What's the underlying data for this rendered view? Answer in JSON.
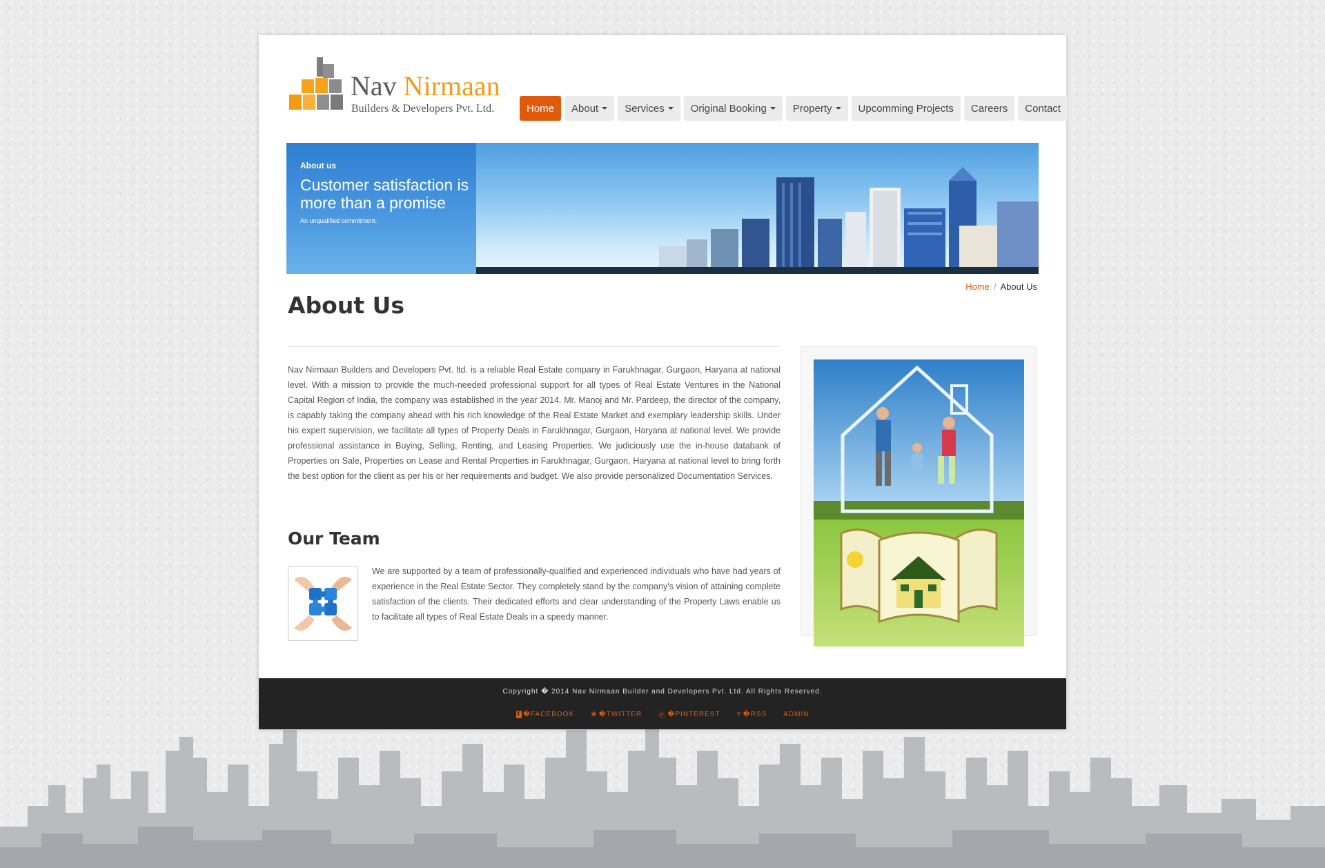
{
  "brand": {
    "name_first": "Nav",
    "name_second": "Nirmaan",
    "subtitle": "Builders & Developers Pvt. Ltd.",
    "accent_color": "#f39c12"
  },
  "nav": {
    "items": [
      {
        "label": "Home",
        "dropdown": false,
        "active": true
      },
      {
        "label": "About",
        "dropdown": true,
        "active": false
      },
      {
        "label": "Services",
        "dropdown": true,
        "active": false
      },
      {
        "label": "Original Booking",
        "dropdown": true,
        "active": false
      },
      {
        "label": "Property",
        "dropdown": true,
        "active": false
      },
      {
        "label": "Upcomming Projects",
        "dropdown": false,
        "active": false
      },
      {
        "label": "Careers",
        "dropdown": false,
        "active": false
      },
      {
        "label": "Contact",
        "dropdown": false,
        "active": false
      }
    ],
    "active_color": "#e05a0c"
  },
  "banner": {
    "eyebrow": "About us",
    "headline": "Customer satisfaction is more than a promise",
    "tagline": "An unqualified commitment."
  },
  "breadcrumb": {
    "home": "Home",
    "separator": "/",
    "current": "About Us"
  },
  "page": {
    "title": "About Us",
    "intro": "Nav Nirmaan Builders and Developers Pvt. ltd. is a reliable Real Estate company in Farukhnagar, Gurgaon, Haryana at national level. With a mission to provide the much-needed professional support for all types of Real Estate Ventures in the National Capital Region of India, the company was established in the year 2014. Mr. Manoj and Mr. Pardeep, the director of the company, is capably taking the company ahead with his rich knowledge of the Real Estate Market and exemplary leadership skills. Under his expert supervision, we facilitate all types of Property Deals in Farukhnagar, Gurgaon, Haryana at national level. We provide professional assistance in Buying, Selling, Renting, and Leasing Properties. We judiciously use the in-house databank of Properties on Sale, Properties on Lease and Rental Properties in Farukhnagar, Gurgaon, Haryana at national level to bring forth the best option for the client as per his or her requirements and budget. We also provide personalized Documentation Services.",
    "team_title": "Our Team",
    "team_text": "We are supported by a team of professionally-qualified and experienced individuals who have had years of experience in the Real Estate Sector. They completely stand by the company's vision of attaining complete satisfaction of the clients. Their dedicated efforts and clear understanding of the Property Laws enable us to facilitate all types of Real Estate Deals in a speedy manner."
  },
  "footer": {
    "copyright": "Copyright � 2014 Nav Nirmaan Builder and Developers Pvt. Ltd. All Rights Reserved.",
    "links": [
      {
        "icon": "facebook-icon",
        "glyph": "f",
        "label": "�FACEBOOK"
      },
      {
        "icon": "twitter-icon",
        "glyph": "❀",
        "label": "�TWITTER"
      },
      {
        "icon": "pinterest-icon",
        "glyph": "Ⓟ",
        "label": "�PINTEREST"
      },
      {
        "icon": "rss-icon",
        "glyph": "≡",
        "label": "�RSS"
      },
      {
        "icon": "",
        "glyph": "",
        "label": "ADMIN"
      }
    ],
    "link_color": "#e05a0c"
  }
}
